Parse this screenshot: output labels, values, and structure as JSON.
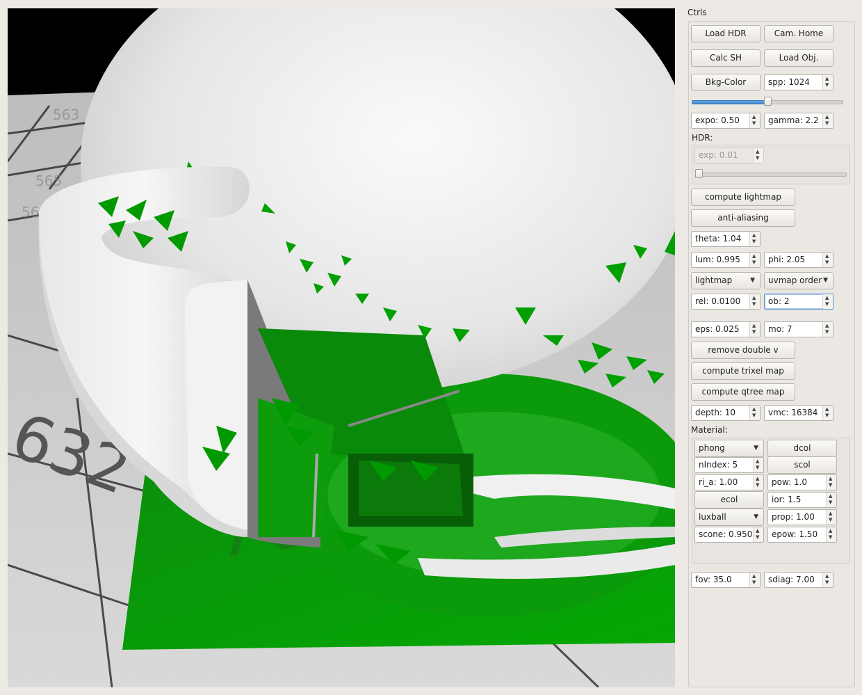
{
  "ctrls_title": "Ctrls",
  "buttons": {
    "load_hdr": "Load HDR",
    "cam_home": "Cam. Home",
    "calc_sh": "Calc SH",
    "load_obj": "Load Obj.",
    "bkg_color": "Bkg-Color",
    "compute_lightmap": "compute lightmap",
    "anti_aliasing": "anti-aliasing",
    "remove_double_v": "remove double v",
    "compute_trixel_map": "compute trixel map",
    "compute_qtree_map": "compute qtree map"
  },
  "fields": {
    "spp": "spp: 1024",
    "expo": "expo: 0.50",
    "gamma": "gamma: 2.2",
    "theta": "theta: 1.04",
    "lum": "lum: 0.995",
    "phi": "phi: 2.05",
    "rel": "rel: 0.0100",
    "ob": "ob: 2",
    "eps": "eps: 0.025",
    "mo": "mo: 7",
    "depth": "depth: 10",
    "vmc": "vmc: 16384",
    "fov": "fov: 35.0",
    "sdiag": "sdiag: 7.00"
  },
  "spp_slider_fraction": 0.5,
  "hdr": {
    "label": "HDR:",
    "exp": "exp: 0.01",
    "slider_fraction": 0.0
  },
  "selects": {
    "lightmap": "lightmap",
    "uvmap_order": "uvmap order"
  },
  "material": {
    "label": "Material:",
    "shader": "phong",
    "dcol": "dcol",
    "nindex": "nIndex: 5",
    "scol": "scol",
    "ri_a": "ri_a: 1.00",
    "pow": "pow: 1.0",
    "ecol": "ecol",
    "ior": "ior: 1.5",
    "luxball": "luxball",
    "prop": "prop: 1.00",
    "scone": "scone: 0.950",
    "epow": "epow: 1.50"
  },
  "scene_labels": [
    "563",
    "564",
    "565",
    "566",
    "632",
    "700"
  ],
  "colors": {
    "accent_green": "#00aa00",
    "slider_blue": "#3d86cc",
    "panel_bg": "#ebe8e3",
    "floor": "#c9c9c9"
  }
}
